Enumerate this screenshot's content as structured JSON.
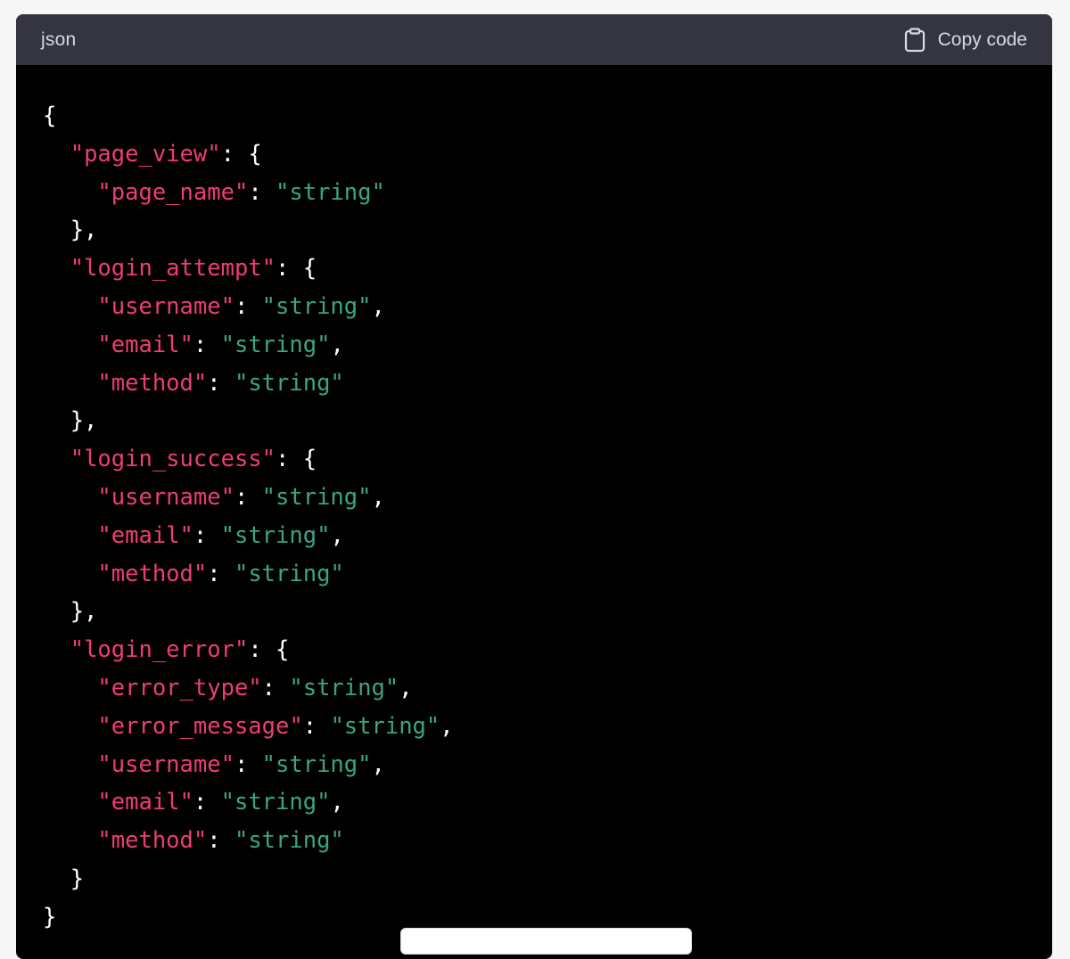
{
  "code_block": {
    "language": "json",
    "copy_label": "Copy code",
    "copy_icon": "clipboard-icon",
    "colors": {
      "header_bg": "#343541",
      "body_bg": "#000000",
      "key": "#ee3d72",
      "string": "#3aa487",
      "punctuation": "#ffffff"
    },
    "lines": [
      [
        {
          "t": "p",
          "v": "{"
        }
      ],
      [
        {
          "t": "p",
          "v": "  "
        },
        {
          "t": "k",
          "v": "\"page_view\""
        },
        {
          "t": "p",
          "v": ": {"
        }
      ],
      [
        {
          "t": "p",
          "v": "    "
        },
        {
          "t": "k",
          "v": "\"page_name\""
        },
        {
          "t": "p",
          "v": ": "
        },
        {
          "t": "s",
          "v": "\"string\""
        }
      ],
      [
        {
          "t": "p",
          "v": "  },"
        }
      ],
      [
        {
          "t": "p",
          "v": "  "
        },
        {
          "t": "k",
          "v": "\"login_attempt\""
        },
        {
          "t": "p",
          "v": ": {"
        }
      ],
      [
        {
          "t": "p",
          "v": "    "
        },
        {
          "t": "k",
          "v": "\"username\""
        },
        {
          "t": "p",
          "v": ": "
        },
        {
          "t": "s",
          "v": "\"string\""
        },
        {
          "t": "p",
          "v": ","
        }
      ],
      [
        {
          "t": "p",
          "v": "    "
        },
        {
          "t": "k",
          "v": "\"email\""
        },
        {
          "t": "p",
          "v": ": "
        },
        {
          "t": "s",
          "v": "\"string\""
        },
        {
          "t": "p",
          "v": ","
        }
      ],
      [
        {
          "t": "p",
          "v": "    "
        },
        {
          "t": "k",
          "v": "\"method\""
        },
        {
          "t": "p",
          "v": ": "
        },
        {
          "t": "s",
          "v": "\"string\""
        }
      ],
      [
        {
          "t": "p",
          "v": "  },"
        }
      ],
      [
        {
          "t": "p",
          "v": "  "
        },
        {
          "t": "k",
          "v": "\"login_success\""
        },
        {
          "t": "p",
          "v": ": {"
        }
      ],
      [
        {
          "t": "p",
          "v": "    "
        },
        {
          "t": "k",
          "v": "\"username\""
        },
        {
          "t": "p",
          "v": ": "
        },
        {
          "t": "s",
          "v": "\"string\""
        },
        {
          "t": "p",
          "v": ","
        }
      ],
      [
        {
          "t": "p",
          "v": "    "
        },
        {
          "t": "k",
          "v": "\"email\""
        },
        {
          "t": "p",
          "v": ": "
        },
        {
          "t": "s",
          "v": "\"string\""
        },
        {
          "t": "p",
          "v": ","
        }
      ],
      [
        {
          "t": "p",
          "v": "    "
        },
        {
          "t": "k",
          "v": "\"method\""
        },
        {
          "t": "p",
          "v": ": "
        },
        {
          "t": "s",
          "v": "\"string\""
        }
      ],
      [
        {
          "t": "p",
          "v": "  },"
        }
      ],
      [
        {
          "t": "p",
          "v": "  "
        },
        {
          "t": "k",
          "v": "\"login_error\""
        },
        {
          "t": "p",
          "v": ": {"
        }
      ],
      [
        {
          "t": "p",
          "v": "    "
        },
        {
          "t": "k",
          "v": "\"error_type\""
        },
        {
          "t": "p",
          "v": ": "
        },
        {
          "t": "s",
          "v": "\"string\""
        },
        {
          "t": "p",
          "v": ","
        }
      ],
      [
        {
          "t": "p",
          "v": "    "
        },
        {
          "t": "k",
          "v": "\"error_message\""
        },
        {
          "t": "p",
          "v": ": "
        },
        {
          "t": "s",
          "v": "\"string\""
        },
        {
          "t": "p",
          "v": ","
        }
      ],
      [
        {
          "t": "p",
          "v": "    "
        },
        {
          "t": "k",
          "v": "\"username\""
        },
        {
          "t": "p",
          "v": ": "
        },
        {
          "t": "s",
          "v": "\"string\""
        },
        {
          "t": "p",
          "v": ","
        }
      ],
      [
        {
          "t": "p",
          "v": "    "
        },
        {
          "t": "k",
          "v": "\"email\""
        },
        {
          "t": "p",
          "v": ": "
        },
        {
          "t": "s",
          "v": "\"string\""
        },
        {
          "t": "p",
          "v": ","
        }
      ],
      [
        {
          "t": "p",
          "v": "    "
        },
        {
          "t": "k",
          "v": "\"method\""
        },
        {
          "t": "p",
          "v": ": "
        },
        {
          "t": "s",
          "v": "\"string\""
        }
      ],
      [
        {
          "t": "p",
          "v": "  }"
        }
      ],
      [
        {
          "t": "p",
          "v": "}"
        }
      ]
    ]
  }
}
